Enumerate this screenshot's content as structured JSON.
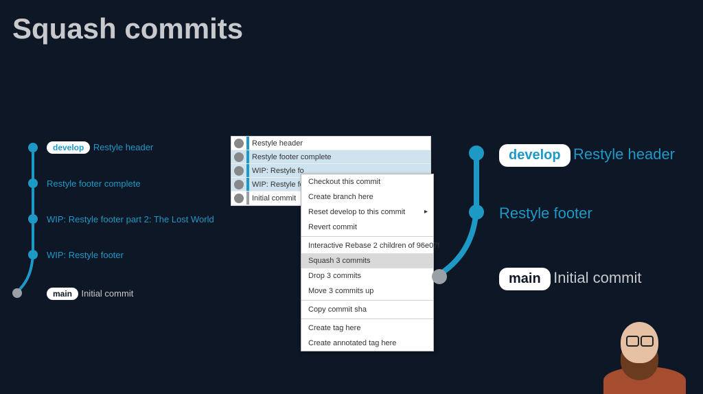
{
  "title": "Squash commits",
  "branches": {
    "develop": "develop",
    "main": "main"
  },
  "left_graph": {
    "commits": [
      {
        "label": "Restyle header",
        "branch": "develop"
      },
      {
        "label": "Restyle footer complete"
      },
      {
        "label": "WIP: Restyle footer part 2: The Lost World"
      },
      {
        "label": "WIP: Restyle footer"
      }
    ],
    "initial": {
      "label": "Initial commit",
      "branch": "main"
    }
  },
  "right_graph": {
    "commits": [
      {
        "label": "Restyle header",
        "branch": "develop"
      },
      {
        "label": "Restyle footer"
      }
    ],
    "initial": {
      "label": "Initial commit",
      "branch": "main"
    }
  },
  "app": {
    "rows": [
      {
        "msg": "Restyle header",
        "selected": false
      },
      {
        "msg": "Restyle footer complete",
        "selected": true
      },
      {
        "msg": "WIP: Restyle fo",
        "selected": true
      },
      {
        "msg": "WIP: Restyle fo",
        "selected": true
      },
      {
        "msg": "Initial commit",
        "selected": false
      }
    ]
  },
  "context_menu": {
    "items": [
      {
        "label": "Checkout this commit"
      },
      {
        "label": "Create branch here"
      },
      {
        "label": "Reset develop to this commit",
        "submenu": true
      },
      {
        "label": "Revert commit"
      }
    ],
    "group2": [
      {
        "label": "Interactive Rebase 2 children of 96e07f"
      },
      {
        "label": "Squash 3 commits",
        "highlighted": true
      },
      {
        "label": "Drop 3 commits"
      },
      {
        "label": "Move 3 commits up"
      }
    ],
    "group3": [
      {
        "label": "Copy commit sha"
      }
    ],
    "group4": [
      {
        "label": "Create tag here"
      },
      {
        "label": "Create annotated tag here"
      }
    ]
  }
}
